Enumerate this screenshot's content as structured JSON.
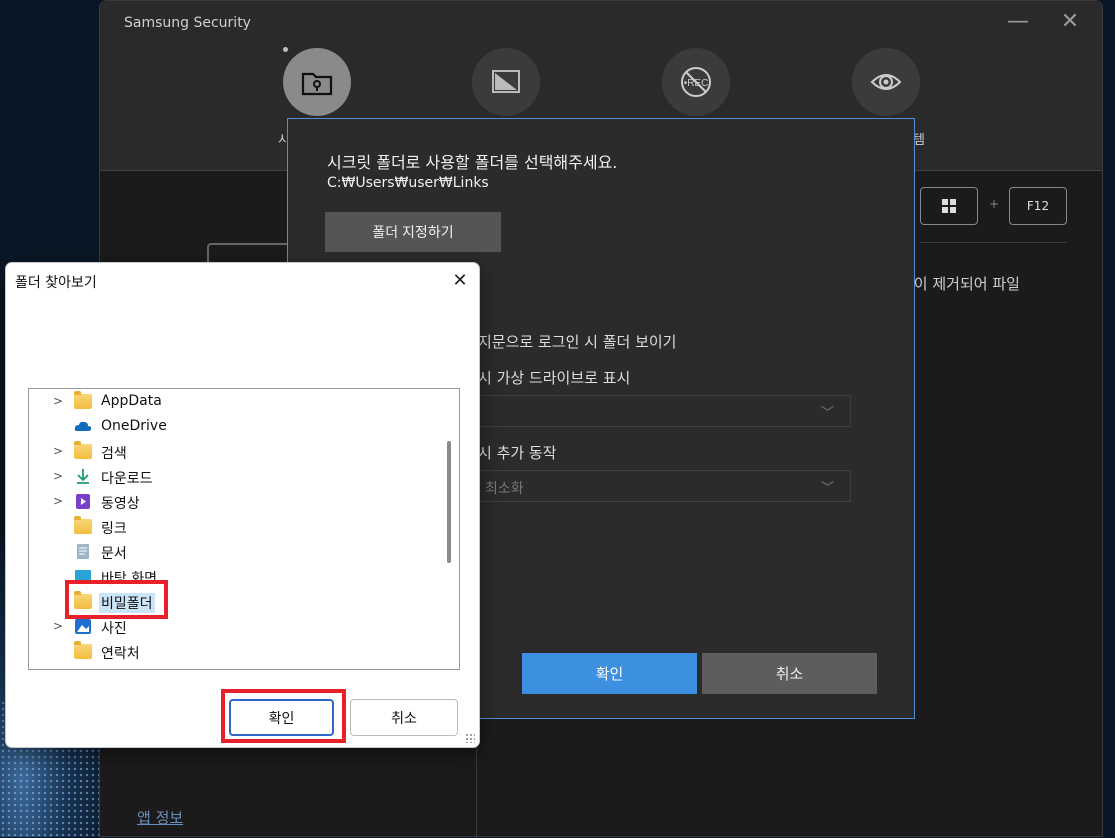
{
  "app": {
    "title": "Samsung Security",
    "window_minimize": "—",
    "window_close": "✕",
    "nav_peek_left": "시",
    "nav_peek_right": "템",
    "shortcut_key2": "F12",
    "shortcut_plus": "+",
    "description_fragment": "성이 제거되어 파일",
    "about_link": "앱 정보"
  },
  "secret_dialog": {
    "title": "시크릿 폴더로 사용할 폴더를 선택해주세요.",
    "path": "C:₩Users₩user₩Links",
    "folder_button": "폴더 지정하기",
    "option1_label": "지문으로 로그인 시 폴더 보이기",
    "option2_label": "시 가상 드라이브로 표시",
    "option2_value": "",
    "option3_label": "시 추가 동작",
    "option3_value": "최소화",
    "ok": "확인",
    "cancel": "취소"
  },
  "browse_dialog": {
    "title": "폴더 찾아보기",
    "close": "✕",
    "tree": [
      {
        "label": "AppData",
        "expander": ">",
        "icon": "folder-icon"
      },
      {
        "label": "OneDrive",
        "expander": "",
        "icon": "cloud-icon"
      },
      {
        "label": "검색",
        "expander": ">",
        "icon": "folder-icon"
      },
      {
        "label": "다운로드",
        "expander": ">",
        "icon": "download-icon"
      },
      {
        "label": "동영상",
        "expander": ">",
        "icon": "video-icon"
      },
      {
        "label": "링크",
        "expander": "",
        "icon": "folder-icon"
      },
      {
        "label": "문서",
        "expander": "",
        "icon": "document-icon"
      },
      {
        "label": "바탕 화면",
        "expander": "",
        "icon": "desktop-icon"
      },
      {
        "label": "비밀폴더",
        "expander": "",
        "icon": "folder-icon",
        "selected": true
      },
      {
        "label": "사진",
        "expander": ">",
        "icon": "pictures-icon"
      },
      {
        "label": "연락처",
        "expander": "",
        "icon": "folder-icon"
      }
    ],
    "ok": "확인",
    "cancel": "취소"
  },
  "colors": {
    "accent_blue": "#3d8fe0",
    "highlight_red": "#e8202a",
    "selection": "#cce4f7"
  }
}
